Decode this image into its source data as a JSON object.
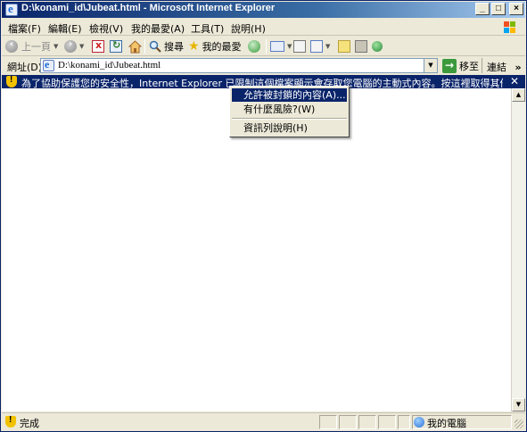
{
  "window": {
    "title": "D:\\konami_id\\Jubeat.html - Microsoft Internet Explorer",
    "buttons": {
      "minimize": "_",
      "maximize": "□",
      "close": "×"
    }
  },
  "menubar": {
    "items": [
      {
        "label": "檔案(F)"
      },
      {
        "label": "編輯(E)"
      },
      {
        "label": "檢視(V)"
      },
      {
        "label": "我的最愛(A)"
      },
      {
        "label": "工具(T)"
      },
      {
        "label": "說明(H)"
      }
    ]
  },
  "toolbar": {
    "back_label": "上一頁",
    "search_label": "搜尋",
    "favorites_label": "我的最愛"
  },
  "address": {
    "label": "網址(D)",
    "value": "D:\\konami_id\\Jubeat.html",
    "go_label": "移至",
    "links_label": "連結"
  },
  "infobar": {
    "text": "為了協助保護您的安全性，Internet Explorer 已限制這個檔案顯示會存取您電腦的主動式內容。按這裡取得其他資訊..."
  },
  "context_menu": {
    "items": [
      {
        "label": "允許被封鎖的內容(A)..."
      },
      {
        "label": "有什麼風險?(W)"
      },
      {
        "label": "資訊列說明(H)"
      }
    ],
    "selected": "允許被封鎖的內容(A)..."
  },
  "statusbar": {
    "text": "完成",
    "zone": "我的電腦"
  }
}
